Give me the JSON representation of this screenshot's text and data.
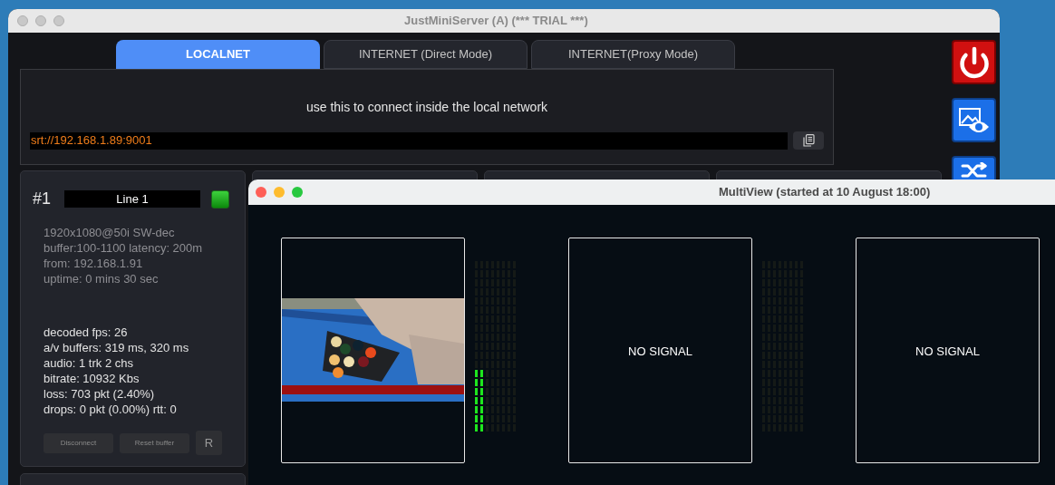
{
  "main_window": {
    "title": "JustMiniServer (A) (*** TRIAL ***)"
  },
  "tabs": [
    {
      "label": "LOCALNET",
      "selected": true
    },
    {
      "label": "INTERNET (Direct Mode)",
      "selected": false
    },
    {
      "label": "INTERNET(Proxy Mode)",
      "selected": false
    }
  ],
  "connection_panel": {
    "hint": "use this to connect inside the local network",
    "url": "srt://192.168.1.89:9001"
  },
  "streams": [
    {
      "number": "#1",
      "name": "Line 1",
      "active": true,
      "info": [
        "1920x1080@50i SW-dec",
        "buffer:100-1100 latency: 200m",
        "from: 192.168.1.91",
        "uptime: 0 mins 30 sec"
      ],
      "stats": [
        "decoded fps: 26",
        "a/v buffers: 319 ms, 320 ms",
        "audio: 1 trk 2 chs",
        "bitrate: 10932 Kbs",
        "loss: 703 pkt (2.40%)",
        "drops: 0 pkt (0.00%) rtt: 0"
      ],
      "buttons": [
        "Disconnect",
        "Reset buffer",
        "R"
      ]
    }
  ],
  "multiview": {
    "title": "MultiView (started at 10 August 18:00)",
    "tiles": [
      {
        "kind": "video",
        "meter": [
          {
            "level": 0.37
          },
          {
            "level": 0.37
          },
          {
            "level": 0
          },
          {
            "level": 0
          },
          {
            "level": 0
          },
          {
            "level": 0
          },
          {
            "level": 0
          },
          {
            "level": 0
          }
        ]
      },
      {
        "kind": "no_signal",
        "label": "NO SIGNAL",
        "meter": [
          {
            "level": 0
          },
          {
            "level": 0
          },
          {
            "level": 0
          },
          {
            "level": 0
          },
          {
            "level": 0
          },
          {
            "level": 0
          },
          {
            "level": 0
          },
          {
            "level": 0
          }
        ]
      },
      {
        "kind": "no_signal",
        "label": "NO SIGNAL"
      }
    ]
  }
}
